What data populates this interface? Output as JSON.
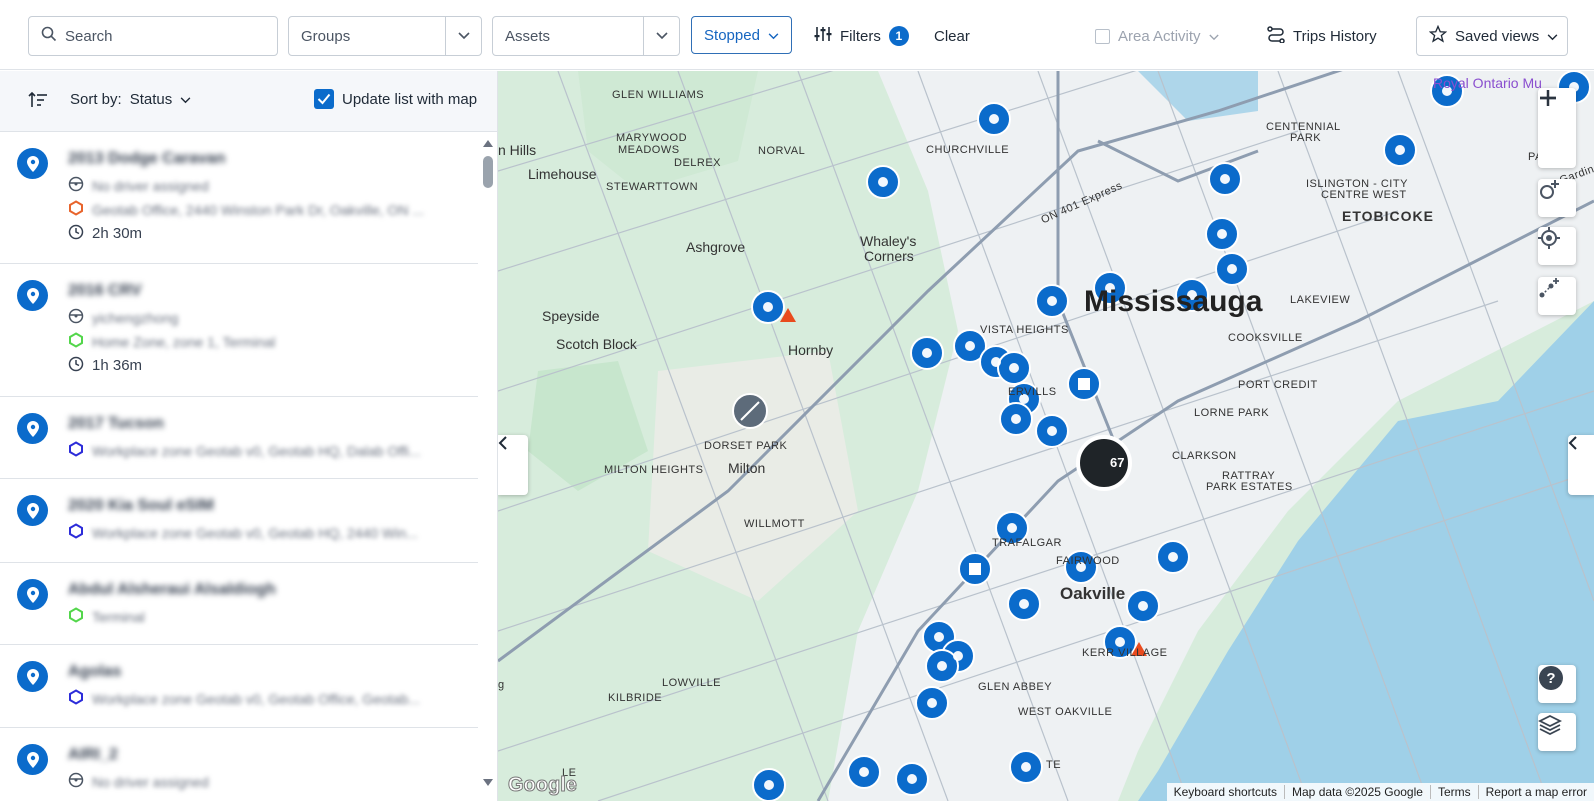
{
  "topbar": {
    "search_placeholder": "Search",
    "groups_placeholder": "Groups",
    "assets_placeholder": "Assets",
    "status_filter": "Stopped",
    "filters_label": "Filters",
    "filters_count": "1",
    "clear_label": "Clear",
    "area_activity_label": "Area Activity",
    "trips_history_label": "Trips History",
    "saved_views_label": "Saved views"
  },
  "sidebar": {
    "sort_label": "Sort by:",
    "sort_value": "Status",
    "update_list_label": "Update list with map",
    "update_list_checked": true,
    "items": [
      {
        "name": "2013 Dodge Caravan",
        "driver": "No driver assigned",
        "location": "Geotab Office, 2440 Winston Park Dr, Oakville, ON ...",
        "duration": "2h 30m"
      },
      {
        "name": "2016 CRV",
        "driver": "yichengzhong",
        "location": "Home Zone, zone 1, Terminal",
        "duration": "1h 36m"
      },
      {
        "name": "2017 Tucson",
        "location": "Workplace zone Geotab v0, Geotab HQ, Dalab Offi..."
      },
      {
        "name": "2020 Kia Soul eSIM",
        "location": "Workplace zone Geotab v0, Geotab HQ, 2440 Win..."
      },
      {
        "name": "Abdul Alsheraui Alsaldiogh",
        "location": "Terminal"
      },
      {
        "name": "Agolas",
        "location": "Workplace zone Geotab v0, Geotab Office, Geotab..."
      },
      {
        "name": "AIRI_2",
        "driver": "No driver assigned"
      }
    ]
  },
  "map": {
    "cluster_count": "67",
    "labels": {
      "glen_williams": "GLEN WILLIAMS",
      "maryward": "MARYWOOD",
      "meadows": "MEADOWS",
      "delrex": "DELREX",
      "norval": "NORVAL",
      "churchville": "CHURCHVILLE",
      "stewarttown": "STEWARTTOWN",
      "limehouse": "Limehouse",
      "hills": "n Hills",
      "ashgrove": "Ashgrove",
      "whaleys": "Whaley's",
      "corners": "Corners",
      "speyside": "Speyside",
      "scotch_block": "Scotch Block",
      "hornby": "Hornby",
      "mississauga": "Mississauga",
      "vista_heights": "VISTA HEIGHTS",
      "centennial": "CENTENNIAL",
      "park": "PARK",
      "islington": "ISLINGTON - CITY",
      "centre_west": "CENTRE WEST",
      "etobicoke": "ETOBICOKE",
      "lakeview": "LAKEVIEW",
      "cooksville": "COOKSVILLE",
      "port_credit": "PORT CREDIT",
      "lorne_park": "LORNE PARK",
      "dorset_park": "DORSET PARK",
      "milton_heights": "MILTON HEIGHTS",
      "milton": "Milton",
      "clarkson": "CLARKSON",
      "rattray": "RATTRAY",
      "park_estates": "PARK ESTATES",
      "willmott": "WILLMOTT",
      "trafalgar": "TRAFALGAR",
      "fairwood": "FAIRWOOD",
      "oakville": "Oakville",
      "kerr_village": "KERR VILLAGE",
      "glen_abbey": "GLEN ABBEY",
      "west_oakville": "WEST OAKVILLE",
      "lowville": "LOWVILLE",
      "kilbride": "KILBRIDE",
      "royal_ontario": "Royal Ontario Mu",
      "ervills": "ERVILLS",
      "on401": "ON 401 Express",
      "gardiner": "Gardiner Exp",
      "parkdale": "PARK",
      "te": "TE",
      "le": "LE",
      "g": "g"
    },
    "attribution": {
      "shortcuts": "Keyboard shortcuts",
      "data": "Map data ©2025 Google",
      "terms": "Terms",
      "report": "Report a map error"
    },
    "logo": "Google"
  }
}
